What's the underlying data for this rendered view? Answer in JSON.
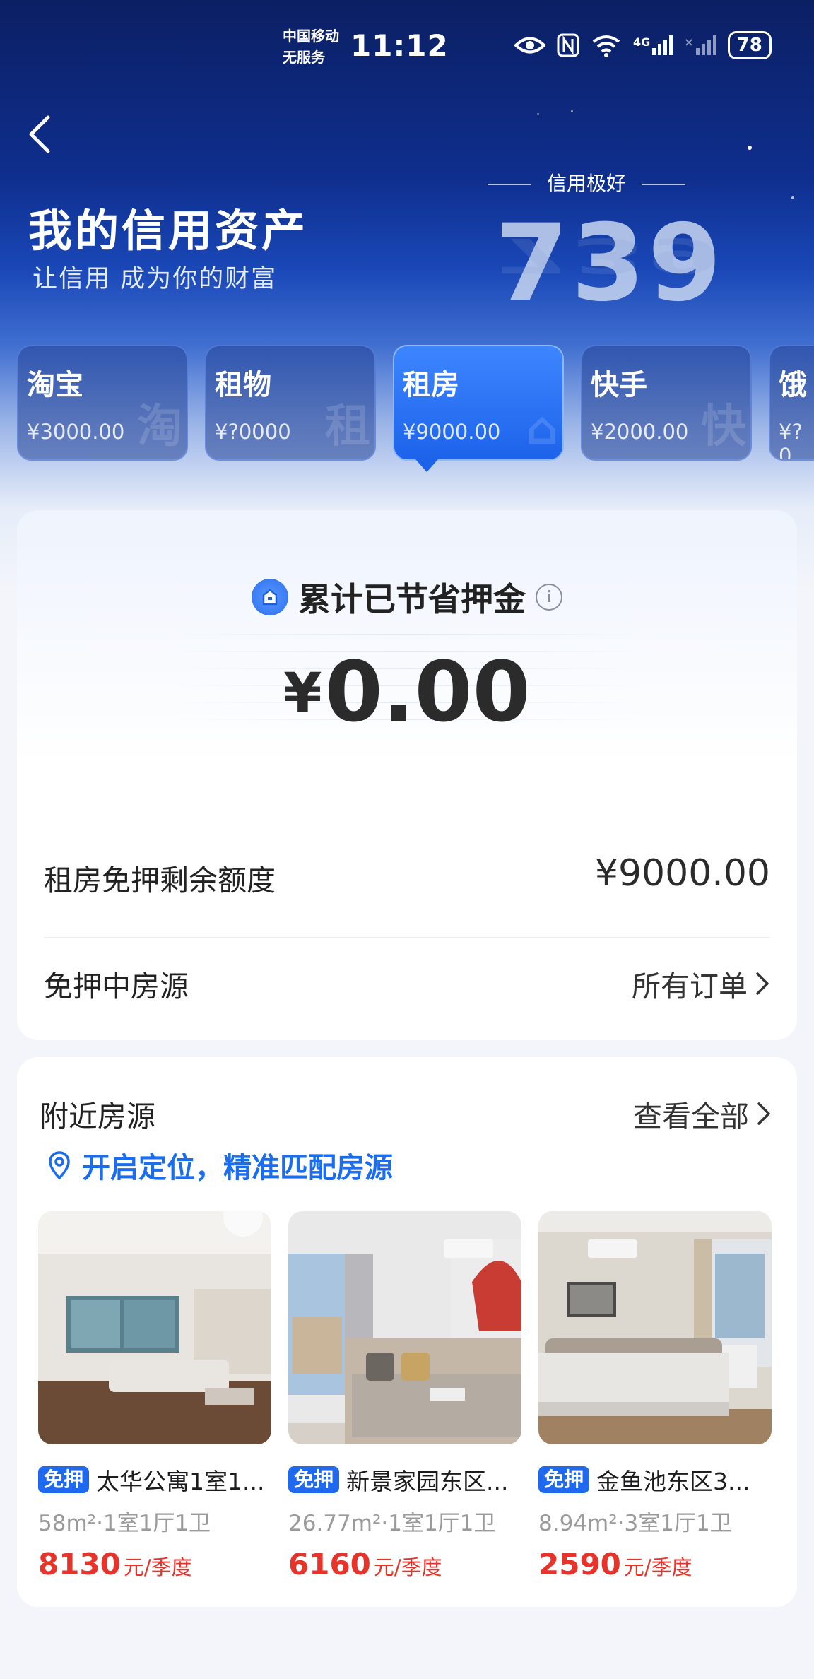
{
  "status_bar": {
    "carrier_line1": "中国移动",
    "carrier_line2": "无服务",
    "time": "11:12",
    "network": "4G",
    "battery": "78"
  },
  "header": {
    "title": "我的信用资产",
    "subtitle": "让信用 成为你的财富",
    "credit_level": "信用极好",
    "credit_score": "739"
  },
  "categories": [
    {
      "name": "淘宝",
      "amount": "¥3000.00",
      "watermark": "淘"
    },
    {
      "name": "租物",
      "amount": "¥?0000",
      "watermark": "租"
    },
    {
      "name": "租房",
      "amount": "¥9000.00",
      "watermark": "⌂"
    },
    {
      "name": "快手",
      "amount": "¥2000.00",
      "watermark": "快"
    },
    {
      "name": "饿",
      "amount": "¥?0",
      "watermark": ""
    }
  ],
  "deposit": {
    "title": "累计已节省押金",
    "info_icon": "info-icon",
    "currency": "¥",
    "value": "0.00",
    "quota_label": "租房免押剩余额度",
    "quota_value": "¥9000.00",
    "houses_label": "免押中房源",
    "all_orders": "所有订单"
  },
  "nearby": {
    "title": "附近房源",
    "view_all": "查看全部",
    "locate_text": "开启定位，精准匹配房源",
    "houses": [
      {
        "tag": "免押",
        "name": "太华公寓1室1...",
        "spec": "58m²·1室1厅1卫",
        "price": "8130",
        "unit": "元/季度"
      },
      {
        "tag": "免押",
        "name": "新景家园东区...",
        "spec": "26.77m²·1室1厅1卫",
        "price": "6160",
        "unit": "元/季度"
      },
      {
        "tag": "免押",
        "name": "金鱼池东区3...",
        "spec": "8.94m²·3室1厅1卫",
        "price": "2590",
        "unit": "元/季度"
      }
    ]
  },
  "colors": {
    "accent_blue": "#1f68f0",
    "price_red": "#e8332b",
    "hero_dark": "#0b1f63"
  }
}
